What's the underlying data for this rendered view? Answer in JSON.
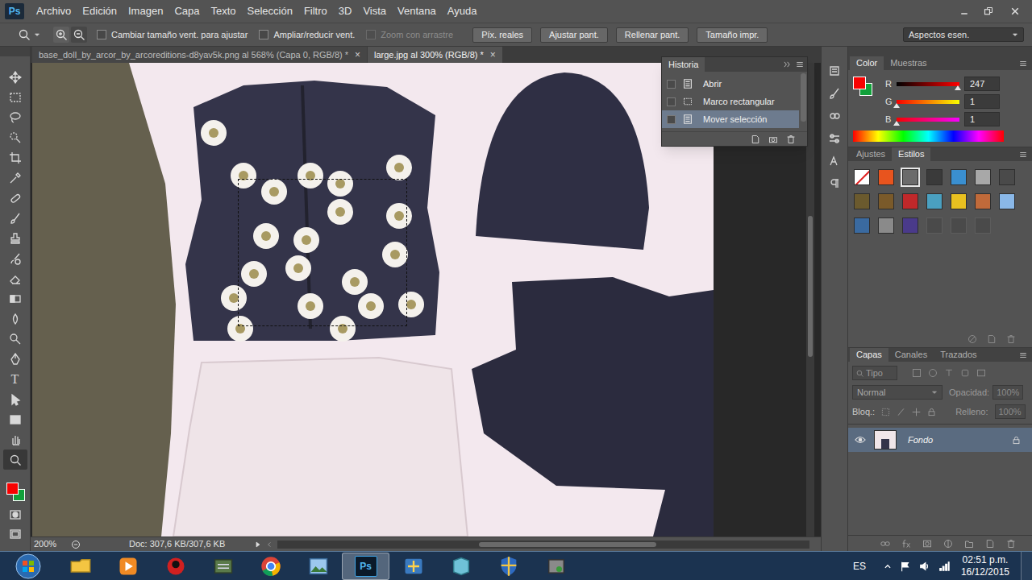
{
  "app": {
    "logo": "Ps"
  },
  "menu": [
    "Archivo",
    "Edición",
    "Imagen",
    "Capa",
    "Texto",
    "Selección",
    "Filtro",
    "3D",
    "Vista",
    "Ventana",
    "Ayuda"
  ],
  "options_bar": {
    "checkboxes": [
      {
        "label": "Cambiar tamaño vent. para ajustar",
        "checked": false,
        "disabled": false
      },
      {
        "label": "Ampliar/reducir vent.",
        "checked": false,
        "disabled": false
      },
      {
        "label": "Zoom con arrastre",
        "checked": false,
        "disabled": true
      }
    ],
    "buttons": [
      "Píx. reales",
      "Ajustar pant.",
      "Rellenar pant.",
      "Tamaño impr."
    ],
    "workspace": "Aspectos esen."
  },
  "tabs": [
    {
      "label": "base_doll_by_arcor_by_arcoreditions-d8yav5k.png al 568% (Capa 0, RGB/8) *",
      "close": "×",
      "selected": false
    },
    {
      "label": "large.jpg al 300% (RGB/8) *",
      "close": "×",
      "selected": true
    }
  ],
  "tools": [
    {
      "kind": "move",
      "selected": false
    },
    {
      "kind": "marquee",
      "selected": false
    },
    {
      "kind": "lasso",
      "selected": false
    },
    {
      "kind": "quick-select",
      "selected": false
    },
    {
      "kind": "crop",
      "selected": false
    },
    {
      "kind": "eyedropper",
      "selected": false
    },
    {
      "kind": "healing",
      "selected": false
    },
    {
      "kind": "brush",
      "selected": false
    },
    {
      "kind": "stamp",
      "selected": false
    },
    {
      "kind": "history-brush",
      "selected": false
    },
    {
      "kind": "eraser",
      "selected": false
    },
    {
      "kind": "gradient",
      "selected": false
    },
    {
      "kind": "blur",
      "selected": false
    },
    {
      "kind": "dodge",
      "selected": false
    },
    {
      "kind": "pen",
      "selected": false
    },
    {
      "kind": "type",
      "label": "T",
      "selected": false
    },
    {
      "kind": "path-select",
      "selected": false
    },
    {
      "kind": "shape",
      "selected": false
    },
    {
      "kind": "hand",
      "selected": false
    },
    {
      "kind": "zoom",
      "selected": true
    }
  ],
  "history": {
    "title": "Historia",
    "items": [
      {
        "label": "Abrir",
        "kind": "document",
        "selected": false
      },
      {
        "label": "Marco rectangular",
        "kind": "marquee",
        "selected": false
      },
      {
        "label": "Mover selección",
        "kind": "document",
        "selected": true
      }
    ]
  },
  "color_panel": {
    "tabs": [
      {
        "label": "Color",
        "selected": true
      },
      {
        "label": "Muestras",
        "selected": false
      }
    ],
    "foreground": "#f70101",
    "background": "#11a03a",
    "channels": [
      {
        "name": "R",
        "value": "247",
        "level": 0.97,
        "kind": "red"
      },
      {
        "name": "G",
        "value": "1",
        "level": 0.0,
        "kind": "green"
      },
      {
        "name": "B",
        "value": "1",
        "level": 0.0,
        "kind": "blue"
      }
    ]
  },
  "styles_panel": {
    "tabs": [
      {
        "label": "Ajustes",
        "selected": false
      },
      {
        "label": "Estilos",
        "selected": true
      }
    ],
    "swatches": [
      {
        "color": "#ffffff",
        "kind": "none",
        "selected": false
      },
      {
        "color": "#e8541e",
        "kind": "plain",
        "selected": false
      },
      {
        "color": "#6b6b6b",
        "kind": "plain",
        "selected": true
      },
      {
        "color": "#3a3a3a",
        "kind": "plain",
        "selected": false
      },
      {
        "color": "#3a8fd0",
        "kind": "plain",
        "selected": false
      },
      {
        "color": "#a8a8a8",
        "kind": "plain",
        "selected": false
      },
      {
        "color": "#4a4a4a",
        "kind": "plain",
        "selected": false
      },
      {
        "color": "#6b5a2e",
        "kind": "plain",
        "selected": false
      },
      {
        "color": "#7a5a2a",
        "kind": "plain",
        "selected": false
      },
      {
        "color": "#c0282a",
        "kind": "plain",
        "selected": false
      },
      {
        "color": "#4aa0c0",
        "kind": "plain",
        "selected": false
      },
      {
        "color": "#e8c020",
        "kind": "plain",
        "selected": false
      },
      {
        "color": "#c06a3a",
        "kind": "plain",
        "selected": false
      },
      {
        "color": "#8ab8e8",
        "kind": "plain",
        "selected": false
      },
      {
        "color": "#3a6aa0",
        "kind": "plain",
        "selected": false
      },
      {
        "color": "#8a8a8a",
        "kind": "plain",
        "selected": false
      },
      {
        "color": "#4a3a8a",
        "kind": "plain",
        "selected": false
      },
      {
        "color": "#4a4a4a",
        "kind": "empty",
        "selected": false
      },
      {
        "color": "#4a4a4a",
        "kind": "empty",
        "selected": false
      },
      {
        "color": "#4a4a4a",
        "kind": "empty",
        "selected": false
      }
    ]
  },
  "layers_panel": {
    "tabs": [
      {
        "label": "Capas",
        "selected": true
      },
      {
        "label": "Canales",
        "selected": false
      },
      {
        "label": "Trazados",
        "selected": false
      }
    ],
    "filter": "Tipo",
    "blend_mode": "Normal",
    "opacity_label": "Opacidad:",
    "opacity": "100%",
    "opacity_disabled": true,
    "lock_label": "Bloq.:",
    "fill_label": "Relleno:",
    "fill": "100%",
    "fill_disabled": true,
    "layers": [
      {
        "name": "Fondo",
        "visible": true,
        "locked": true,
        "selected": true
      }
    ]
  },
  "status_bar": {
    "zoom": "200%",
    "doc": "Doc: 307,6 KB/307,6 KB"
  },
  "taskbar": {
    "apps": [
      {
        "kind": "explorer",
        "active": false
      },
      {
        "kind": "media",
        "active": false
      },
      {
        "kind": "game",
        "active": false
      },
      {
        "kind": "stack",
        "active": false
      },
      {
        "kind": "chrome",
        "active": false
      },
      {
        "kind": "photos",
        "active": false
      },
      {
        "kind": "photoshop",
        "label": "Ps",
        "active": true
      },
      {
        "kind": "network",
        "active": false
      },
      {
        "kind": "notes",
        "active": false
      },
      {
        "kind": "shield",
        "active": false
      },
      {
        "kind": "installer",
        "active": false
      }
    ],
    "language": "ES",
    "time": "02:51 p.m.",
    "date": "16/12/2015"
  }
}
